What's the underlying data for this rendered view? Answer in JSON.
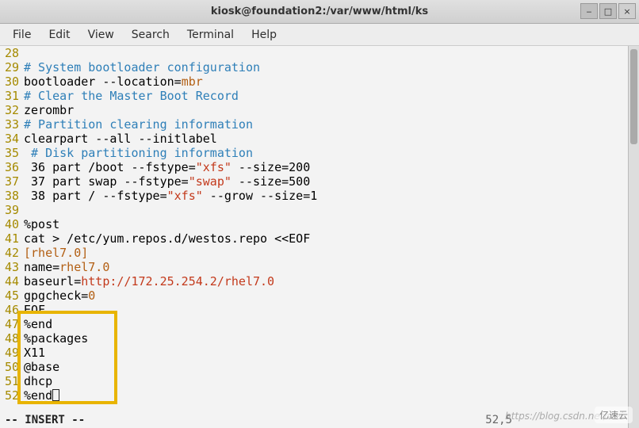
{
  "title": "kiosk@foundation2:/var/www/html/ks",
  "window_controls": {
    "minimize": "‒",
    "maximize": "□",
    "close": "×"
  },
  "menu": [
    "File",
    "Edit",
    "View",
    "Search",
    "Terminal",
    "Help"
  ],
  "lines": [
    {
      "n": "28",
      "segs": [
        {
          "t": "",
          "c": ""
        }
      ]
    },
    {
      "n": "29",
      "segs": [
        {
          "t": "# System bootloader configuration",
          "c": "c-comment"
        }
      ]
    },
    {
      "n": "30",
      "segs": [
        {
          "t": "bootloader --location=",
          "c": ""
        },
        {
          "t": "mbr",
          "c": "c-key"
        }
      ]
    },
    {
      "n": "31",
      "segs": [
        {
          "t": "# Clear the Master Boot Record",
          "c": "c-comment"
        }
      ]
    },
    {
      "n": "32",
      "segs": [
        {
          "t": "zerombr",
          "c": ""
        }
      ]
    },
    {
      "n": "33",
      "segs": [
        {
          "t": "# Partition clearing information",
          "c": "c-comment"
        }
      ]
    },
    {
      "n": "34",
      "segs": [
        {
          "t": "clearpart --all --initlabel",
          "c": ""
        }
      ]
    },
    {
      "n": "35",
      "segs": [
        {
          "t": " # Disk partitioning information",
          "c": "c-comment"
        }
      ]
    },
    {
      "n": "36",
      "segs": [
        {
          "t": " 36 part /boot --fstype=",
          "c": ""
        },
        {
          "t": "\"xfs\"",
          "c": "c-str"
        },
        {
          "t": " --size=200",
          "c": ""
        }
      ]
    },
    {
      "n": "37",
      "segs": [
        {
          "t": " 37 part swap --fstype=",
          "c": ""
        },
        {
          "t": "\"swap\"",
          "c": "c-str"
        },
        {
          "t": " --size=500",
          "c": ""
        }
      ]
    },
    {
      "n": "38",
      "segs": [
        {
          "t": " 38 part / --fstype=",
          "c": ""
        },
        {
          "t": "\"xfs\"",
          "c": "c-str"
        },
        {
          "t": " --grow --size=1",
          "c": ""
        }
      ]
    },
    {
      "n": "39",
      "segs": [
        {
          "t": "",
          "c": ""
        }
      ]
    },
    {
      "n": "40",
      "segs": [
        {
          "t": "%post",
          "c": ""
        }
      ]
    },
    {
      "n": "41",
      "segs": [
        {
          "t": "cat > /etc/yum.repos.d/westos.repo <<EOF",
          "c": ""
        }
      ]
    },
    {
      "n": "42",
      "segs": [
        {
          "t": "[rhel7.0]",
          "c": "c-noeol"
        }
      ]
    },
    {
      "n": "43",
      "segs": [
        {
          "t": "name=",
          "c": ""
        },
        {
          "t": "rhel7.0",
          "c": "c-key"
        }
      ]
    },
    {
      "n": "44",
      "segs": [
        {
          "t": "baseurl=",
          "c": ""
        },
        {
          "t": "http://172.25.254.2/rhel7.0",
          "c": "c-str"
        }
      ]
    },
    {
      "n": "45",
      "segs": [
        {
          "t": "gpgcheck=",
          "c": ""
        },
        {
          "t": "0",
          "c": "c-key"
        }
      ]
    },
    {
      "n": "46",
      "segs": [
        {
          "t": "EOF",
          "c": ""
        }
      ]
    },
    {
      "n": "47",
      "segs": [
        {
          "t": "%end",
          "c": ""
        }
      ]
    },
    {
      "n": "48",
      "segs": [
        {
          "t": "%packages",
          "c": ""
        }
      ]
    },
    {
      "n": "49",
      "segs": [
        {
          "t": "X11",
          "c": ""
        }
      ]
    },
    {
      "n": "50",
      "segs": [
        {
          "t": "@base",
          "c": ""
        }
      ]
    },
    {
      "n": "51",
      "segs": [
        {
          "t": "dhcp",
          "c": ""
        }
      ]
    },
    {
      "n": "52",
      "segs": [
        {
          "t": "%end",
          "c": ""
        }
      ],
      "cursor": true
    }
  ],
  "status": {
    "mode": "-- INSERT --",
    "position": "52,5"
  },
  "watermark": "https://blog.csdn.net/wei",
  "logo": "亿速云"
}
